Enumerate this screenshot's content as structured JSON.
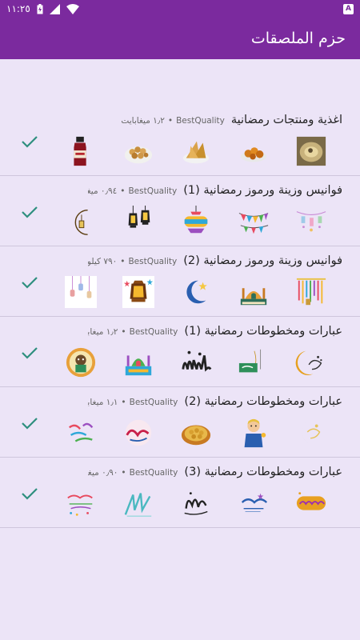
{
  "status_bar": {
    "time": "١١:٢٥",
    "notif_badge": "A"
  },
  "app_bar": {
    "title": "حزم الملصقات"
  },
  "packs": [
    {
      "name": "اغذية ومنتجات رمضانية",
      "author": "BestQuality",
      "size": "١٫٢ ميغابايت",
      "stickers": [
        "food-pot-sticker",
        "food-dish-sticker",
        "sambusa-sticker",
        "dates-bowl-sticker",
        "vimto-bottle-sticker"
      ]
    },
    {
      "name": "فوانيس وزينة ورموز رمضانية (1)",
      "author": "BestQuality",
      "size": "٠٫٩٤ ميغابايت",
      "stickers": [
        "lanterns-garland-sticker",
        "bunting-sticker",
        "lantern-colorful-sticker",
        "lanterns-hanging-sticker",
        "crescent-lantern-sticker"
      ]
    },
    {
      "name": "فوانيس وزينة ورموز رمضانية (2)",
      "author": "BestQuality",
      "size": "٧٩٠ كيلوبايت",
      "stickers": [
        "lanterns-fringe-sticker",
        "mosque-sticker",
        "crescent-star-sticker",
        "lantern-stars-sticker",
        "hanging-lamps-sticker"
      ]
    },
    {
      "name": "عبارات ومخطوطات رمضانية (1)",
      "author": "BestQuality",
      "size": "١٫٢ ميغابايت",
      "stickers": [
        "crescent-calligraphy-sticker",
        "ramadan-sign-sticker",
        "ramadan-calligraphy-sticker",
        "mosque-colorful-sticker",
        "character-frame-sticker"
      ]
    },
    {
      "name": "عبارات ومخطوطات رمضانية (2)",
      "author": "BestQuality",
      "size": "١٫١ ميغابايت",
      "stickers": [
        "crescent-green-sticker",
        "child-character-sticker",
        "dessert-tray-sticker",
        "calligraphy-red-sticker",
        "calligraphy-rainbow-sticker"
      ]
    },
    {
      "name": "عبارات ومخطوطات رمضانية (3)",
      "author": "BestQuality",
      "size": "٠٫٩٠ ميغابايت",
      "stickers": [
        "ramadan-kareem-gold-sticker",
        "ramadan-kareem-blue-sticker",
        "calligraphy-black-sticker",
        "calligraphy-teal-sticker",
        "ramadan-kareem-text-sticker"
      ]
    }
  ],
  "colors": {
    "primary": "#7b2a9e",
    "background": "#ece4f7",
    "check": "#2e8f7e"
  }
}
